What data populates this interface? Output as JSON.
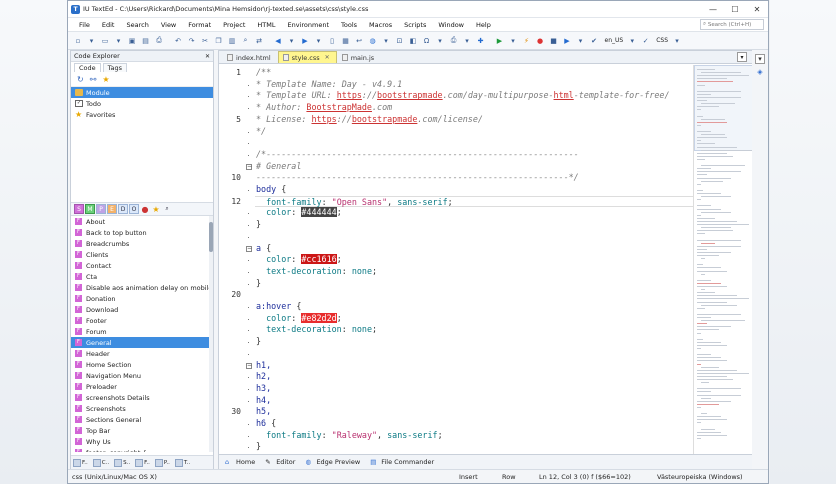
{
  "window": {
    "title": "IU TextEd - C:\\Users\\Rickard\\Documents\\Mina Hemsidor\\rj-texted.se\\assets\\css\\style.css",
    "minimize": "—",
    "maximize": "☐",
    "close": "✕"
  },
  "menu": {
    "items": [
      "File",
      "Edit",
      "Search",
      "View",
      "Format",
      "Project",
      "HTML",
      "Environment",
      "Tools",
      "Macros",
      "Scripts",
      "Window",
      "Help"
    ],
    "search_placeholder": "Search (Ctrl+H)"
  },
  "toolbar": {
    "locale": "en_US",
    "syntax": "CSS"
  },
  "code_explorer": {
    "title": "Code Explorer",
    "close": "✕",
    "tabs": [
      "Code",
      "Tags"
    ],
    "tree": [
      {
        "label": "Module",
        "icon": "folder-icon",
        "selected": true
      },
      {
        "label": "Todo",
        "icon": "checkbox-icon",
        "selected": false
      },
      {
        "label": "Favorites",
        "icon": "star-icon",
        "selected": false
      }
    ],
    "filters": [
      "S",
      "M",
      "P",
      "E",
      "D",
      "O"
    ],
    "symbols": [
      {
        "label": "About",
        "badge": "F"
      },
      {
        "label": "Back to top button",
        "badge": "F"
      },
      {
        "label": "Breadcrumbs",
        "badge": "F"
      },
      {
        "label": "Clients",
        "badge": "F"
      },
      {
        "label": "Contact",
        "badge": "F"
      },
      {
        "label": "Cta",
        "badge": "F"
      },
      {
        "label": "Disable aos animation delay on mobile",
        "badge": "F"
      },
      {
        "label": "Donation",
        "badge": "F"
      },
      {
        "label": "Download",
        "badge": "F"
      },
      {
        "label": "Footer",
        "badge": "F"
      },
      {
        "label": "Forum",
        "badge": "F"
      },
      {
        "label": "General",
        "badge": "F",
        "selected": true
      },
      {
        "label": "Header",
        "badge": "F"
      },
      {
        "label": "Home Section",
        "badge": "F"
      },
      {
        "label": "Navigation Menu",
        "badge": "F"
      },
      {
        "label": "Preloader",
        "badge": "F"
      },
      {
        "label": "screenshots Details",
        "badge": "F"
      },
      {
        "label": "Screenshots",
        "badge": "F"
      },
      {
        "label": "Sections General",
        "badge": "F"
      },
      {
        "label": "Top Bar",
        "badge": "F"
      },
      {
        "label": "Why Us",
        "badge": "F"
      },
      {
        "label": "footer .copyright {",
        "badge": "F"
      }
    ],
    "bottom_tabs": [
      "F..",
      "C..",
      "S..",
      "F..",
      "P..",
      "T.."
    ]
  },
  "file_tabs": [
    {
      "label": "index.html",
      "active": false
    },
    {
      "label": "style.css",
      "active": true
    },
    {
      "label": "main.js",
      "active": false
    }
  ],
  "code": {
    "line_numbers": [
      "1",
      "5",
      "10",
      "12",
      "20",
      "30"
    ],
    "lines": [
      [
        [
          "c-comment",
          "/**"
        ]
      ],
      [
        [
          "c-comment",
          "* Template Name: Day - v4.9.1"
        ]
      ],
      [
        [
          "c-comment",
          "* Template URL: "
        ],
        [
          "c-url",
          "https"
        ],
        [
          "c-comment",
          "://"
        ],
        [
          "c-url",
          "bootstrapmade"
        ],
        [
          "c-comment",
          ".com/day-multipurpose-"
        ],
        [
          "c-url",
          "html"
        ],
        [
          "c-comment",
          "-template-for-free/"
        ]
      ],
      [
        [
          "c-comment",
          "* Author: "
        ],
        [
          "c-url",
          "BootstrapMade"
        ],
        [
          "c-comment",
          ".com"
        ]
      ],
      [
        [
          "c-comment",
          "* License: "
        ],
        [
          "c-url",
          "https"
        ],
        [
          "c-comment",
          "://"
        ],
        [
          "c-url",
          "bootstrapmade"
        ],
        [
          "c-comment",
          ".com/license/"
        ]
      ],
      [
        [
          "c-comment",
          "*/"
        ]
      ],
      [],
      [
        [
          "c-comment",
          "/*--------------------------------------------------------------"
        ]
      ],
      [
        [
          "c-comment",
          "# General"
        ]
      ],
      [
        [
          "c-comment",
          "--------------------------------------------------------------*/"
        ]
      ],
      [
        [
          "c-sel",
          "body"
        ],
        [
          "c-punc",
          " {"
        ]
      ],
      [
        [
          "c-prop",
          "  font-family"
        ],
        [
          "c-punc",
          ": "
        ],
        [
          "c-str",
          "\"Open Sans\""
        ],
        [
          "c-punc",
          ", "
        ],
        [
          "c-val",
          "sans-serif"
        ],
        [
          "c-punc",
          ";"
        ]
      ],
      [
        [
          "c-prop",
          "  color"
        ],
        [
          "c-punc",
          ": "
        ],
        [
          "c-hex-black",
          "#444444"
        ],
        [
          "c-punc",
          ";"
        ]
      ],
      [
        [
          "c-punc",
          "}"
        ]
      ],
      [],
      [
        [
          "c-sel",
          "a"
        ],
        [
          "c-punc",
          " {"
        ]
      ],
      [
        [
          "c-prop",
          "  color"
        ],
        [
          "c-punc",
          ": "
        ],
        [
          "c-hex-red",
          "#cc1616"
        ],
        [
          "c-punc",
          ";"
        ]
      ],
      [
        [
          "c-prop",
          "  text-decoration"
        ],
        [
          "c-punc",
          ": "
        ],
        [
          "c-val",
          "none"
        ],
        [
          "c-punc",
          ";"
        ]
      ],
      [
        [
          "c-punc",
          "}"
        ]
      ],
      [],
      [
        [
          "c-sel",
          "a:hover"
        ],
        [
          "c-punc",
          " {"
        ]
      ],
      [
        [
          "c-prop",
          "  color"
        ],
        [
          "c-punc",
          ": "
        ],
        [
          "c-hex-red2",
          "#e82d2d"
        ],
        [
          "c-punc",
          ";"
        ]
      ],
      [
        [
          "c-prop",
          "  text-decoration"
        ],
        [
          "c-punc",
          ": "
        ],
        [
          "c-val",
          "none"
        ],
        [
          "c-punc",
          ";"
        ]
      ],
      [
        [
          "c-punc",
          "}"
        ]
      ],
      [],
      [
        [
          "c-sel",
          "h1,"
        ]
      ],
      [
        [
          "c-sel",
          "h2,"
        ]
      ],
      [
        [
          "c-sel",
          "h3,"
        ]
      ],
      [
        [
          "c-sel",
          "h4,"
        ]
      ],
      [
        [
          "c-sel",
          "h5,"
        ]
      ],
      [
        [
          "c-sel",
          "h6"
        ],
        [
          "c-punc",
          " {"
        ]
      ],
      [
        [
          "c-prop",
          "  font-family"
        ],
        [
          "c-punc",
          ": "
        ],
        [
          "c-str",
          "\"Raleway\""
        ],
        [
          "c-punc",
          ", "
        ],
        [
          "c-val",
          "sans-serif"
        ],
        [
          "c-punc",
          ";"
        ]
      ],
      [
        [
          "c-punc",
          "}"
        ]
      ]
    ]
  },
  "editor_tabs": [
    "Home",
    "Editor",
    "Edge Preview",
    "File Commander"
  ],
  "status": {
    "encoding": "css (Unix/Linux/Mac OS X)",
    "mode": "Insert",
    "row": "Row",
    "position": "Ln 12, Col 3 (0) f ($66=102)",
    "charset": "Västeuropeiska (Windows)"
  }
}
